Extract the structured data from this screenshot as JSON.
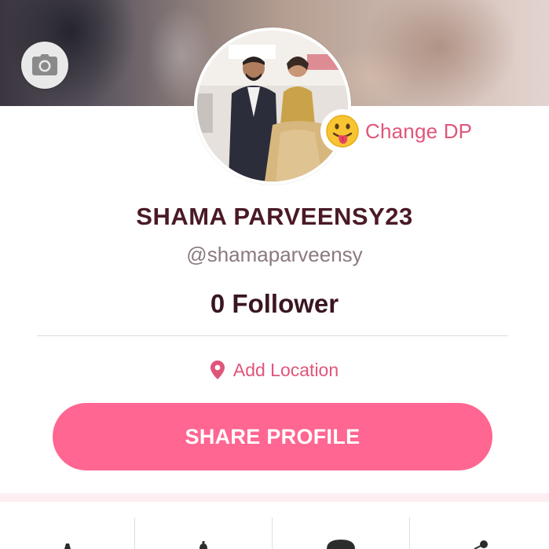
{
  "cover": {
    "camera_icon": "camera-icon"
  },
  "avatar": {
    "alt": "profile picture"
  },
  "change_dp": {
    "emoji": "😛",
    "label": "Change DP"
  },
  "profile": {
    "name": "SHAMA PARVEENSY23",
    "handle": "@shamaparveensy",
    "followers": "0 Follower"
  },
  "location": {
    "icon": "location-pin-icon",
    "label": "Add Location"
  },
  "share": {
    "label": "SHARE PROFILE"
  },
  "colors": {
    "accent": "#e0557a",
    "button": "#ff6691",
    "name": "#4a1a26"
  },
  "tabs": [
    {
      "icon": "tab-icon-1"
    },
    {
      "icon": "tab-icon-2"
    },
    {
      "icon": "tab-icon-3"
    },
    {
      "icon": "tab-icon-4"
    }
  ]
}
